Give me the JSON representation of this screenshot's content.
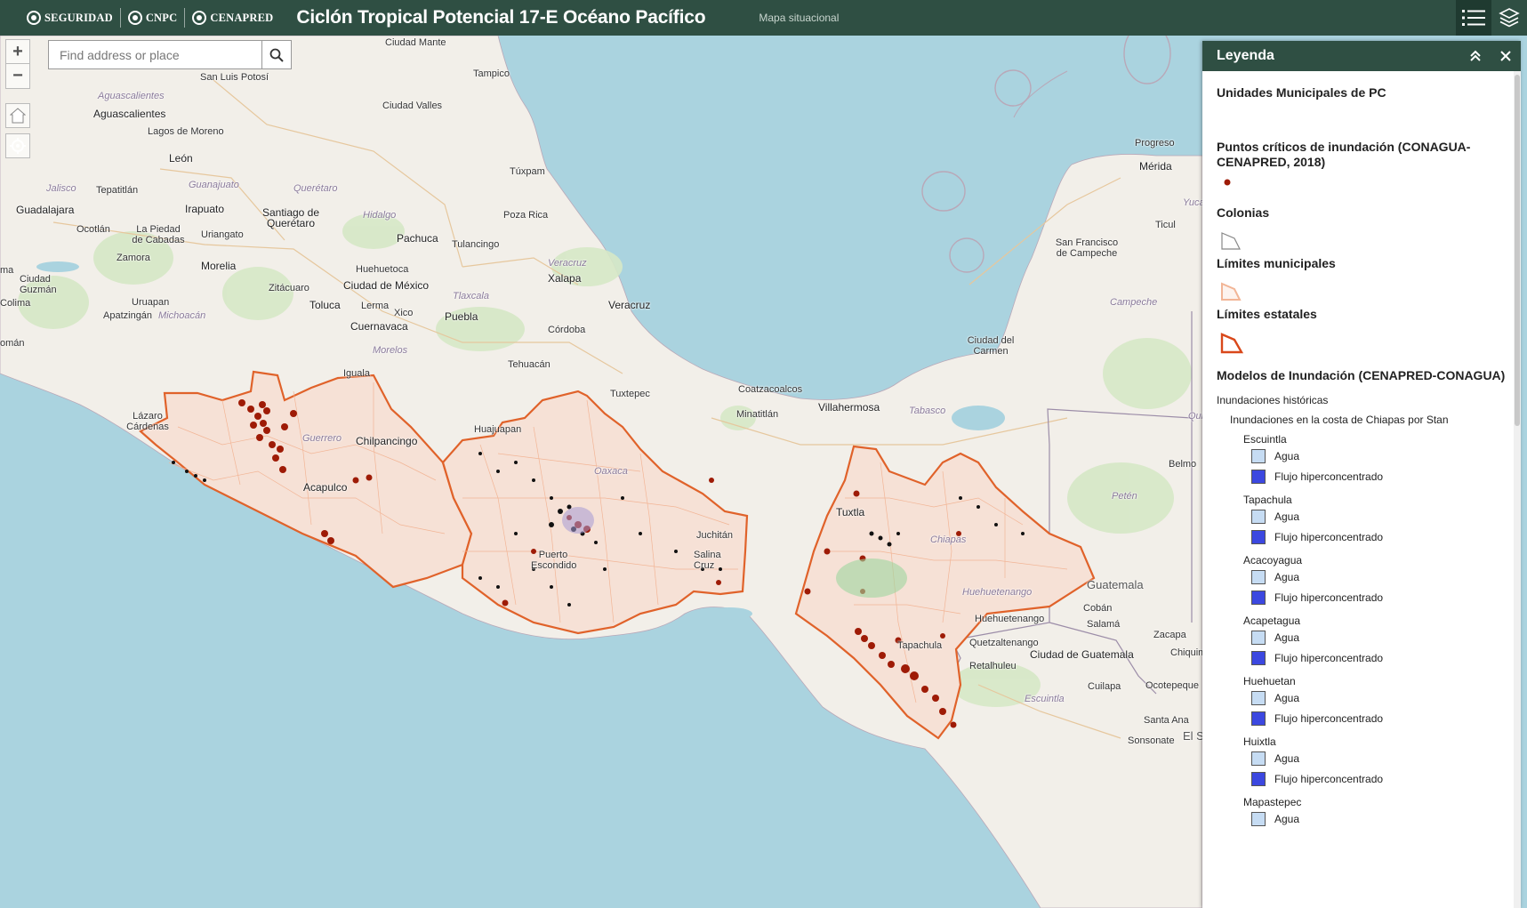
{
  "header": {
    "logos": [
      "SEGURIDAD",
      "CNPC",
      "CENAPRED"
    ],
    "title": "Ciclón Tropical Potencial 17-E Océano Pacífico",
    "subtitle": "Mapa situacional",
    "tools": [
      "legend-list-icon",
      "layers-icon"
    ]
  },
  "search": {
    "placeholder": "Find address or place",
    "value": ""
  },
  "map": {
    "places": [
      {
        "t": "Ciudad Mante"
      },
      {
        "t": "San Luis Potosí"
      },
      {
        "t": "Tampico"
      },
      {
        "t": "Aguascalientes"
      },
      {
        "t": "Aguascalientes"
      },
      {
        "t": "Ciudad Valles"
      },
      {
        "t": "Lagos de Moreno"
      },
      {
        "t": "León"
      },
      {
        "t": "Jalisco"
      },
      {
        "t": "Tepatitlán"
      },
      {
        "t": "Guanajuato"
      },
      {
        "t": "Querétaro"
      },
      {
        "t": "Túxpam"
      },
      {
        "t": "Guadalajara"
      },
      {
        "t": "Irapuato"
      },
      {
        "t": "Santiago de Querétaro"
      },
      {
        "t": "Hidalgo"
      },
      {
        "t": "Poza Rica"
      },
      {
        "t": "Ocotlán"
      },
      {
        "t": "La Piedad de Cabadas"
      },
      {
        "t": "Uriangato"
      },
      {
        "t": "Pachuca"
      },
      {
        "t": "Tulancingo"
      },
      {
        "t": "Zamora"
      },
      {
        "t": "Veracruz"
      },
      {
        "t": "Morelia"
      },
      {
        "t": "Huehuetoca"
      },
      {
        "t": "Xalapa"
      },
      {
        "t": "Ciudad Guzmán"
      },
      {
        "t": "Zitácuaro"
      },
      {
        "t": "Ciudad de México"
      },
      {
        "t": "Tlaxcala"
      },
      {
        "t": "Colima"
      },
      {
        "t": "Uruapan"
      },
      {
        "t": "Toluca"
      },
      {
        "t": "Lerma"
      },
      {
        "t": "Puebla"
      },
      {
        "t": "Veracruz"
      },
      {
        "t": "Apatzingán"
      },
      {
        "t": "Michoacán"
      },
      {
        "t": "Xico"
      },
      {
        "t": "Cuernavaca"
      },
      {
        "t": "Córdoba"
      },
      {
        "t": "Morelos"
      },
      {
        "t": "Iguala"
      },
      {
        "t": "Tehuacán"
      },
      {
        "t": "Lázaro Cárdenas"
      },
      {
        "t": "Guerrero"
      },
      {
        "t": "Chilpancingo"
      },
      {
        "t": "Huajuapan"
      },
      {
        "t": "Acapulco"
      },
      {
        "t": "Oaxaca"
      },
      {
        "t": "Puerto Escondido"
      },
      {
        "t": "Salina Cruz"
      },
      {
        "t": "Juchitán"
      },
      {
        "t": "Tuxtepec"
      },
      {
        "t": "Coatzacoalcos"
      },
      {
        "t": "Minatitlán"
      },
      {
        "t": "Villahermosa"
      },
      {
        "t": "Tabasco"
      },
      {
        "t": "Ciudad del Carmen"
      },
      {
        "t": "Campeche"
      },
      {
        "t": "San Francisco de Campeche"
      },
      {
        "t": "Ticul"
      },
      {
        "t": "Mérida"
      },
      {
        "t": "Progreso"
      },
      {
        "t": "Yucatán"
      },
      {
        "t": "Tuxtla"
      },
      {
        "t": "Chiapas"
      },
      {
        "t": "Huehuetenango"
      },
      {
        "t": "Huehuetenango"
      },
      {
        "t": "Guatemala"
      },
      {
        "t": "Cobán"
      },
      {
        "t": "Petén"
      },
      {
        "t": "Salamá"
      },
      {
        "t": "Zacapa"
      },
      {
        "t": "Quetzaltenango"
      },
      {
        "t": "Ciudad de Guatemala"
      },
      {
        "t": "Tapachula"
      },
      {
        "t": "Retalhuleu"
      },
      {
        "t": "Chiquimula"
      },
      {
        "t": "Cuilapa"
      },
      {
        "t": "Ocotepeque"
      },
      {
        "t": "Escuintla"
      },
      {
        "t": "Santa Ana"
      },
      {
        "t": "Sonsonate"
      },
      {
        "t": "El Sa"
      },
      {
        "t": "Belmo"
      },
      {
        "t": "Quintana"
      },
      {
        "t": "Yuca"
      },
      {
        "t": "omán"
      },
      {
        "t": "ma"
      }
    ]
  },
  "legend": {
    "title": "Leyenda",
    "layers": {
      "upc": "Unidades Municipales de PC",
      "puntos": "Puntos críticos de inundación (CONAGUA-CENAPRED, 2018)",
      "colonias": "Colonias",
      "limites_mun": "Límites municipales",
      "limites_est": "Límites estatales",
      "modelos": "Modelos de Inundación (CENAPRED-CONAGUA)",
      "historicas": "Inundaciones históricas",
      "stan": "Inundaciones en la costa de Chiapas por Stan"
    },
    "groups": [
      {
        "name": "Escuintla",
        "items": [
          "Agua",
          "Flujo hiperconcentrado"
        ]
      },
      {
        "name": "Tapachula",
        "items": [
          "Agua",
          "Flujo hiperconcentrado"
        ]
      },
      {
        "name": "Acacoyagua",
        "items": [
          "Agua",
          "Flujo hiperconcentrado"
        ]
      },
      {
        "name": "Acapetagua",
        "items": [
          "Agua",
          "Flujo hiperconcentrado"
        ]
      },
      {
        "name": "Huehuetan",
        "items": [
          "Agua",
          "Flujo hiperconcentrado"
        ]
      },
      {
        "name": "Huixtla",
        "items": [
          "Agua",
          "Flujo hiperconcentrado"
        ]
      },
      {
        "name": "Mapastepec",
        "items": [
          "Agua"
        ]
      }
    ]
  },
  "colors": {
    "header": "#2f4f43",
    "sea": "#aad3df",
    "land": "#f2efe9",
    "state_border": "#e0622a",
    "muni_border": "#f2b596",
    "muni_fill": "#f6e1d6",
    "critical_point": "#9e1b06",
    "agua_swatch": "#c6dcf3",
    "flujo_swatch": "#3c48e0"
  }
}
